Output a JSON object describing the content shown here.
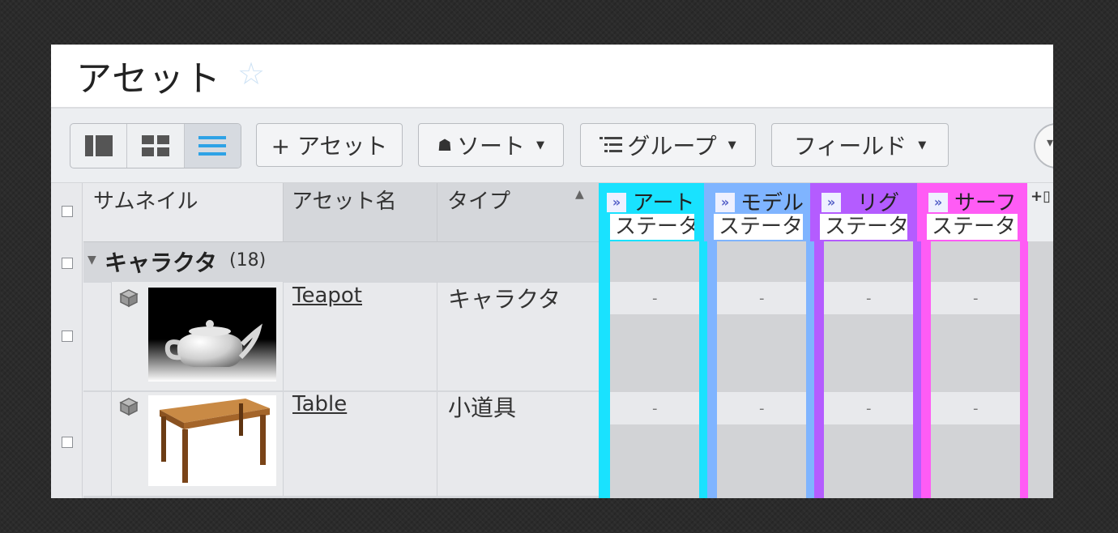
{
  "page": {
    "title": "アセット"
  },
  "toolbar": {
    "add_asset": "+ アセット",
    "sort": "ソート",
    "group": "グループ",
    "fields": "フィールド"
  },
  "columns": {
    "thumbnail": "サムネイル",
    "asset_name": "アセット名",
    "type": "タイプ"
  },
  "stages": [
    {
      "name": "アート",
      "sub": "ステータ",
      "color": "#19e2ff"
    },
    {
      "name": "モデル",
      "sub": "ステータ",
      "color": "#7fb4ff"
    },
    {
      "name": "リグ",
      "sub": "ステータ",
      "color": "#b45cff"
    },
    {
      "name": "サーフ",
      "sub": "ステータ",
      "color": "#ff5cf5"
    }
  ],
  "add_column": "+▯",
  "group": {
    "name": "キャラクタ",
    "count": "(18)"
  },
  "rows": [
    {
      "name": "Teapot",
      "type": "キャラクタ",
      "statuses": [
        "-",
        "-",
        "-",
        "-"
      ]
    },
    {
      "name": "Table",
      "type": "小道具",
      "statuses": [
        "-",
        "-",
        "-",
        "-"
      ]
    }
  ],
  "icons": [
    "star-icon",
    "thumbnail-view-icon",
    "grid-view-icon",
    "list-view-icon",
    "sort-icon",
    "group-icon",
    "asset-cube-icon",
    "expand-stage-icon"
  ]
}
